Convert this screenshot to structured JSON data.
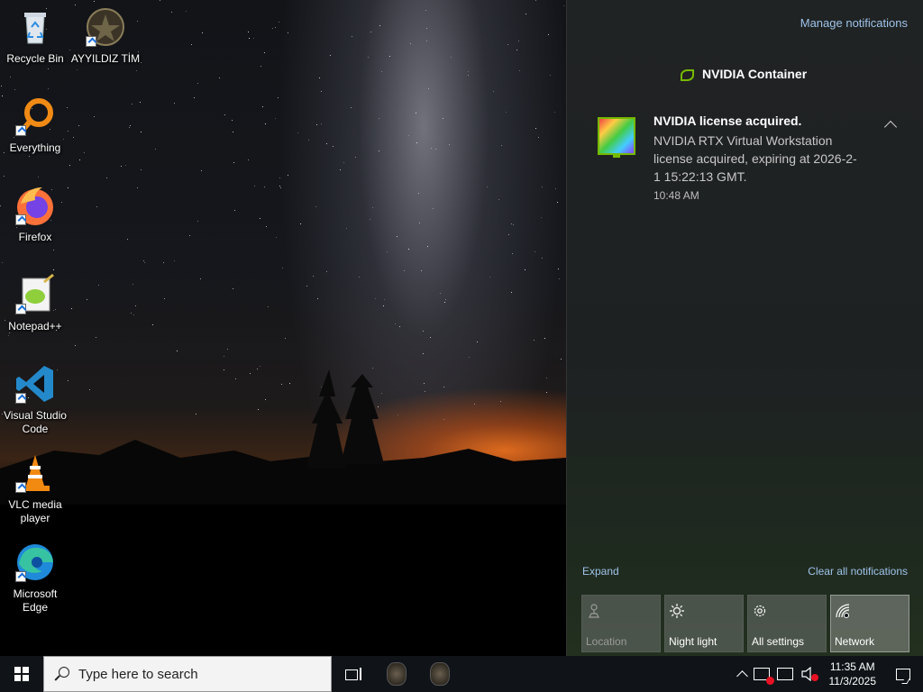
{
  "desktop": {
    "icons": [
      {
        "label": "Recycle Bin",
        "icon": "recycle-bin-icon"
      },
      {
        "label": "AYYILDIZ TİM",
        "icon": "emblem-icon"
      },
      {
        "label": "Everything",
        "icon": "magnifier-icon"
      },
      {
        "label": "Firefox",
        "icon": "firefox-icon"
      },
      {
        "label": "Notepad++",
        "icon": "notepad-plus-plus-icon"
      },
      {
        "label": "Visual Studio Code",
        "icon": "vscode-icon"
      },
      {
        "label": "VLC media player",
        "icon": "vlc-cone-icon"
      },
      {
        "label": "Microsoft Edge",
        "icon": "edge-icon"
      }
    ]
  },
  "action_center": {
    "manage_label": "Manage notifications",
    "app_name": "NVIDIA Container",
    "notification": {
      "title": "NVIDIA license acquired.",
      "body": "NVIDIA RTX Virtual Workstation license acquired, expiring at 2026-2-1 15:22:13 GMT.",
      "time": "10:48 AM"
    },
    "expand_label": "Expand",
    "clear_label": "Clear all notifications",
    "quick_actions": [
      {
        "label": "Location",
        "icon": "location-icon",
        "state": "disabled"
      },
      {
        "label": "Night light",
        "icon": "sun-icon",
        "state": "off"
      },
      {
        "label": "All settings",
        "icon": "gear-icon",
        "state": "off"
      },
      {
        "label": "Network",
        "icon": "network-icon",
        "state": "active"
      }
    ]
  },
  "taskbar": {
    "search_placeholder": "Type here to search",
    "clock_time": "11:35 AM",
    "clock_date": "11/3/2025"
  },
  "colors": {
    "accent_link": "#9ec4ea",
    "nvidia_green": "#76b900",
    "taskbar": "#101418"
  }
}
